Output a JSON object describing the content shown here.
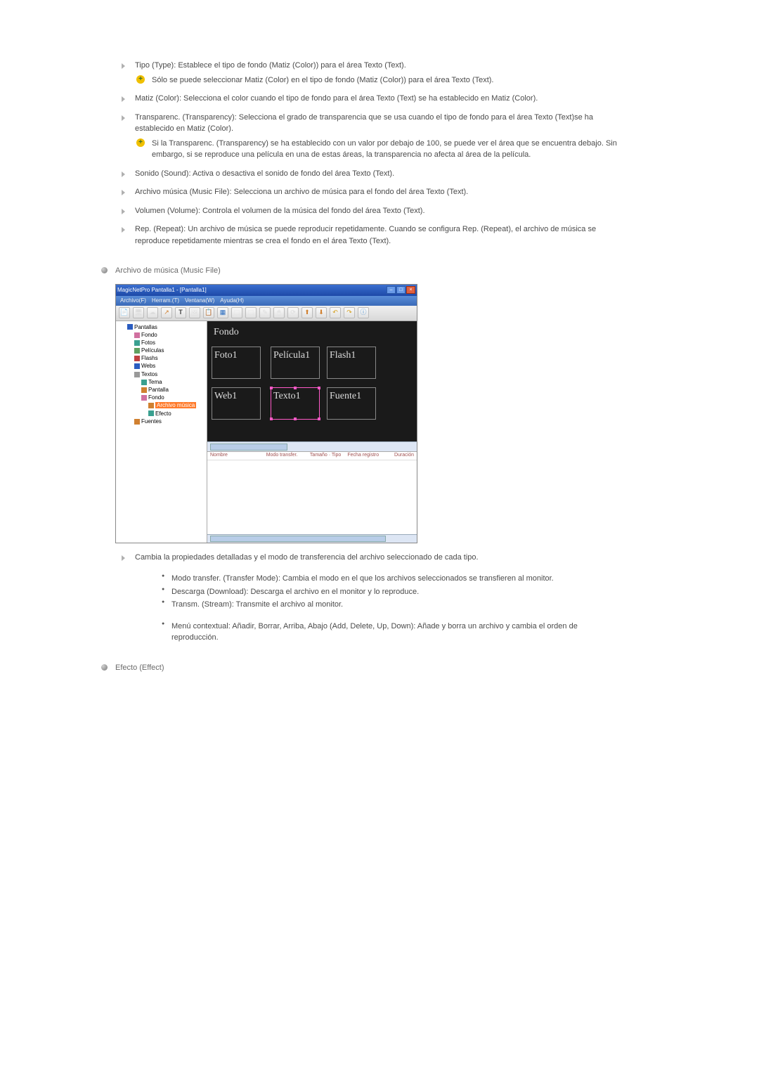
{
  "items": {
    "tipo": "Tipo (Type): Establece el tipo de fondo (Matiz (Color)) para el área Texto (Text).",
    "tipo_note": "Sólo se puede seleccionar Matiz (Color) en el tipo de fondo (Matiz (Color)) para el área Texto (Text).",
    "matiz": "Matiz (Color): Selecciona el color cuando el tipo de fondo para el área Texto (Text) se ha establecido en Matiz (Color).",
    "transp": "Transparenc. (Transparency): Selecciona el grado de transparencia que se usa cuando el tipo de fondo para el área Texto (Text)se ha establecido en Matiz (Color).",
    "transp_note": "Si la Transparenc. (Transparency) se ha establecido con un valor por debajo de 100, se puede ver el área que se encuentra debajo. Sin embargo, si se reproduce una película en una de estas áreas, la transparencia no afecta al área de la película.",
    "sonido": "Sonido (Sound): Activa o desactiva el sonido de fondo del área Texto (Text).",
    "archivo": "Archivo música (Music File): Selecciona un archivo de música para el fondo del área Texto (Text).",
    "volumen": "Volumen (Volume): Controla el volumen de la música del fondo del área Texto (Text).",
    "rep": "Rep. (Repeat): Un archivo de música se puede reproducir repetidamente. Cuando se configura Rep. (Repeat), el archivo de música se reproduce repetidamente mientras se crea el fondo en el área Texto (Text)."
  },
  "section_music": "Archivo de música (Music File)",
  "screenshot": {
    "title": "MagicNetPro Pantalla1 - [Pantalla1]",
    "menu": {
      "archivo": "Archivo(F)",
      "herram": "Herram.(T)",
      "ventana": "Ventana(W)",
      "ayuda": "Ayuda(H)"
    },
    "tree": {
      "n0": "Pantallas",
      "n1": "Fondo",
      "n2": "Fotos",
      "n3": "Películas",
      "n4": "Flashs",
      "n5": "Webs",
      "n6": "Textos",
      "n7": "Tema",
      "n8": "Pantalla",
      "n9": "Fondo",
      "n10": "Archivo música",
      "n11": "Efecto",
      "n12": "Fuentes"
    },
    "canvas": {
      "fondo": "Fondo",
      "foto1": "Foto1",
      "pelicula1": "Película1",
      "flash1": "Flash1",
      "web1": "Web1",
      "texto1": "Texto1",
      "fuente1": "Fuente1"
    },
    "grid": {
      "h1": "Nombre",
      "h2": "Modo transfer.",
      "h3": "Tamaño · Tipo",
      "h4": "Fecha registro",
      "h5": "Duración"
    }
  },
  "post_shot_text": "Cambia la propiedades detalladas y el modo de transferencia del archivo seleccionado de cada tipo.",
  "bullets1": {
    "b1": "Modo transfer. (Transfer Mode): Cambia el modo en el que los archivos seleccionados se transfieren al monitor.",
    "b2": "Descarga (Download): Descarga el archivo en el monitor y lo reproduce.",
    "b3": "Transm. (Stream): Transmite el archivo al monitor."
  },
  "bullets2": {
    "b1": "Menú contextual: Añadir, Borrar, Arriba, Abajo (Add, Delete, Up, Down): Añade y borra un archivo y cambia el orden de reproducción."
  },
  "section_effect": "Efecto (Effect)"
}
